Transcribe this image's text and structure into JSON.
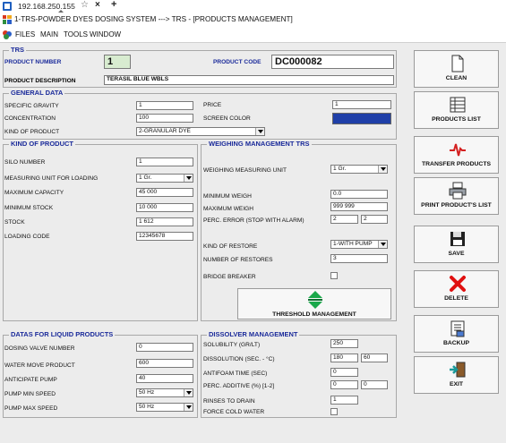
{
  "browser": {
    "address": "192.168.250.155",
    "star": "☆",
    "close": "×",
    "plus": "+"
  },
  "window": {
    "title": "1-TRS-POWDER DYES DOSING SYSTEM ---> TRS - [PRODUCTS MANAGEMENT]"
  },
  "menu": [
    "FILES",
    "MAIN",
    "TOOLS",
    "WINDOW"
  ],
  "trs": {
    "title": "TRS",
    "product_number_label": "PRODUCT NUMBER",
    "product_number": "1",
    "product_code_label": "PRODUCT CODE",
    "product_code": "DC000082",
    "product_description_label": "PRODUCT DESCRIPTION",
    "product_description": "TERASIL BLUE WBLS"
  },
  "general": {
    "title": "GENERAL DATA",
    "specific_gravity_label": "SPECIFIC GRAVITY",
    "specific_gravity": "1",
    "concentration_label": "CONCENTRATION",
    "concentration": "100",
    "kind_label": "KIND OF PRODUCT",
    "kind": "2-GRANULAR DYE",
    "price_label": "PRICE",
    "price": "1",
    "screen_color_label": "SCREEN COLOR",
    "screen_color": "#1f3fa8"
  },
  "kind_of_product": {
    "title": "KIND OF PRODUCT",
    "silo_label": "SILO NUMBER",
    "silo": "1",
    "unit_label": "MEASURING UNIT FOR LOADING",
    "unit": "1 Gr.",
    "max_capacity_label": "MAXIMUM CAPACITY",
    "max_capacity": "45 000",
    "min_stock_label": "MINIMUM STOCK",
    "min_stock": "10 000",
    "stock_label": "STOCK",
    "stock": "1 612",
    "loading_code_label": "LOADING CODE",
    "loading_code": "12345678"
  },
  "weighing": {
    "title": "WEIGHING MANAGEMENT TRS",
    "unit_label": "WEIGHING MEASURING UNIT",
    "unit": "1 Gr.",
    "min_weigh_label": "MINIMUM WEIGH",
    "min_weigh": "0.0",
    "max_weigh_label": "MAXIMUM WEIGH",
    "max_weigh": "999 999",
    "perc_error_label": "PERC. ERROR (STOP WITH ALARM)",
    "perc_error_1": "2",
    "perc_error_2": "2",
    "restore_label": "KIND OF RESTORE",
    "restore": "1-WITH PUMP",
    "num_restores_label": "NUMBER OF RESTORES",
    "num_restores": "3",
    "bridge_breaker_label": "BRIDGE BREAKER",
    "threshold_label": "THRESHOLD MANAGEMENT"
  },
  "liquid": {
    "title": "DATAS FOR LIQUID PRODUCTS",
    "dosing_valve_label": "DOSING VALVE NUMBER",
    "dosing_valve": "0",
    "water_move_label": "WATER MOVE PRODUCT",
    "water_move": "600",
    "anticipate_label": "ANTICIPATE PUMP",
    "anticipate": "40",
    "pump_min_label": "PUMP MIN SPEED",
    "pump_min": "50 Hz",
    "pump_max_label": "PUMP MAX SPEED",
    "pump_max": "50 Hz"
  },
  "dissolver": {
    "title": "DISSOLVER MANAGEMENT",
    "solubility_label": "SOLUBILITY (GR/LT)",
    "solubility": "250",
    "dissolution_label": "DISSOLUTION (SEC. - °C)",
    "dissolution_1": "180",
    "dissolution_2": "60",
    "antifoam_label": "ANTIFOAM TIME (SEC)",
    "antifoam": "0",
    "perc_additive_label": "PERC. ADDITIVE (%) [1-2]",
    "perc_additive_1": "0",
    "perc_additive_2": "0",
    "rinses_label": "RINSES TO DRAIN",
    "rinses": "1",
    "force_cold_label": "FORCE COLD WATER"
  },
  "actions": {
    "clean": "CLEAN",
    "products_list": "PRODUCTS LIST",
    "transfer": "TRANSFER PRODUCTS",
    "print": "PRINT PRODUCT'S LIST",
    "save": "SAVE",
    "delete": "DELETE",
    "backup": "BACKUP",
    "exit": "EXIT"
  }
}
